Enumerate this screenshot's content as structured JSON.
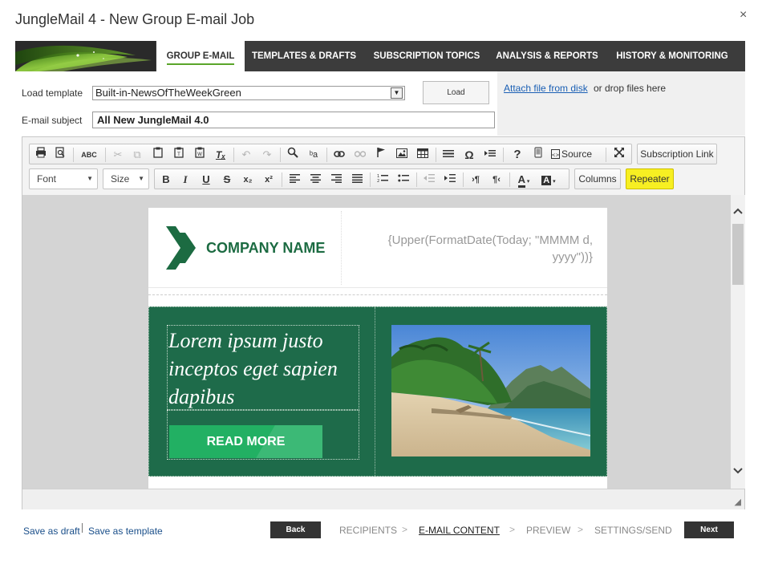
{
  "window": {
    "title": "JungleMail 4 - New Group E-mail Job",
    "close_glyph": "×"
  },
  "tabs": [
    {
      "label": "GROUP E-MAIL",
      "active": true
    },
    {
      "label": "TEMPLATES & DRAFTS"
    },
    {
      "label": "SUBSCRIPTION TOPICS"
    },
    {
      "label": "ANALYSIS & REPORTS"
    },
    {
      "label": "HISTORY & MONITORING"
    }
  ],
  "form": {
    "load_template_label": "Load template",
    "template_value": "Built-in-NewsOfTheWeekGreen",
    "load_button": "Load",
    "subject_label": "E-mail subject",
    "subject_value": "All New JungleMail 4.0",
    "attach_link": "Attach file from disk ",
    "attach_text": "or drop files here"
  },
  "toolbar": {
    "source_label": "Source",
    "subscription_link": "Subscription Link",
    "font_combo": "Font",
    "size_combo": "Size",
    "columns_button": "Columns",
    "repeater_button": "Repeater",
    "glyphs": {
      "bold": "B",
      "italic": "I",
      "underline": "U",
      "strike": "S",
      "subscript": "x₂",
      "superscript": "x²",
      "help": "?",
      "special_char": "Ω",
      "remove_format": "Tₓ",
      "text_color": "A",
      "bg_color": "A",
      "spell": "ABC"
    }
  },
  "email": {
    "company_name": "COMPANY NAME",
    "date_merge": "{Upper(FormatDate(Today; \"MMMM d, yyyy\"))}",
    "hero_heading": "Lorem ipsum justo inceptos eget sapien dapibus",
    "read_more": "READ MORE"
  },
  "footer": {
    "save_draft": "Save as draft",
    "save_template": "Save as template",
    "back": "Back",
    "next": "Next",
    "steps": [
      "RECIPIENTS",
      "E-MAIL CONTENT",
      "PREVIEW",
      "SETTINGS/SEND"
    ],
    "current_step": "E-MAIL CONTENT",
    "step_separator": ">"
  },
  "colors": {
    "tab_bar": "#3c3c3c",
    "tab_active_underline": "#5aa52a",
    "brand_green": "#1c6b42",
    "hero_bg": "#1e6b4a",
    "read_more_bg": "#22b063",
    "repeater_yellow": "#f7ef22",
    "link_blue": "#1a5fb4"
  }
}
